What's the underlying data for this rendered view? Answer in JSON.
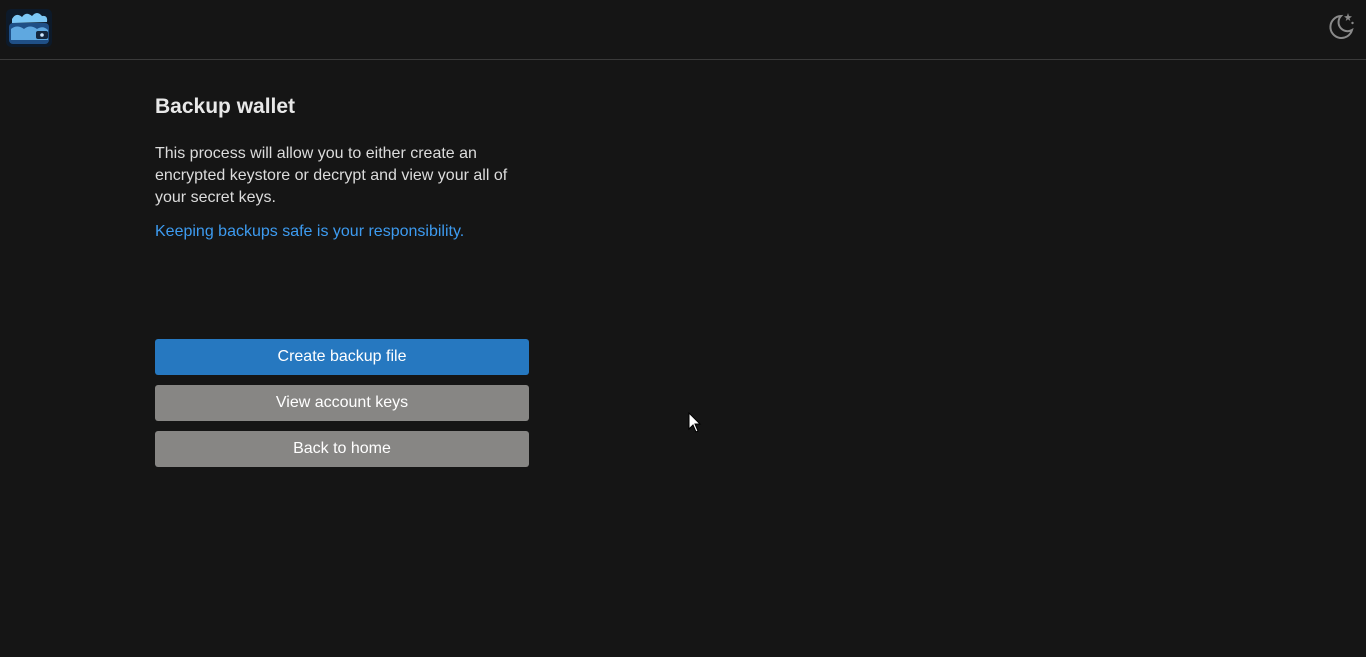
{
  "header": {
    "logo_icon": "wallet-logo-icon",
    "theme_toggle_icon": "moon-stars-icon"
  },
  "main": {
    "title": "Backup wallet",
    "description": "This process will allow you to either create an encrypted keystore or decrypt and view your all of your secret keys.",
    "warning": "Keeping backups safe is your responsibility."
  },
  "actions": {
    "create_backup_label": "Create backup file",
    "view_keys_label": "View account keys",
    "back_home_label": "Back to home"
  },
  "colors": {
    "background": "#151515",
    "primary_button": "#2678c0",
    "secondary_button": "#878684",
    "link_text": "#3d9bf0"
  }
}
